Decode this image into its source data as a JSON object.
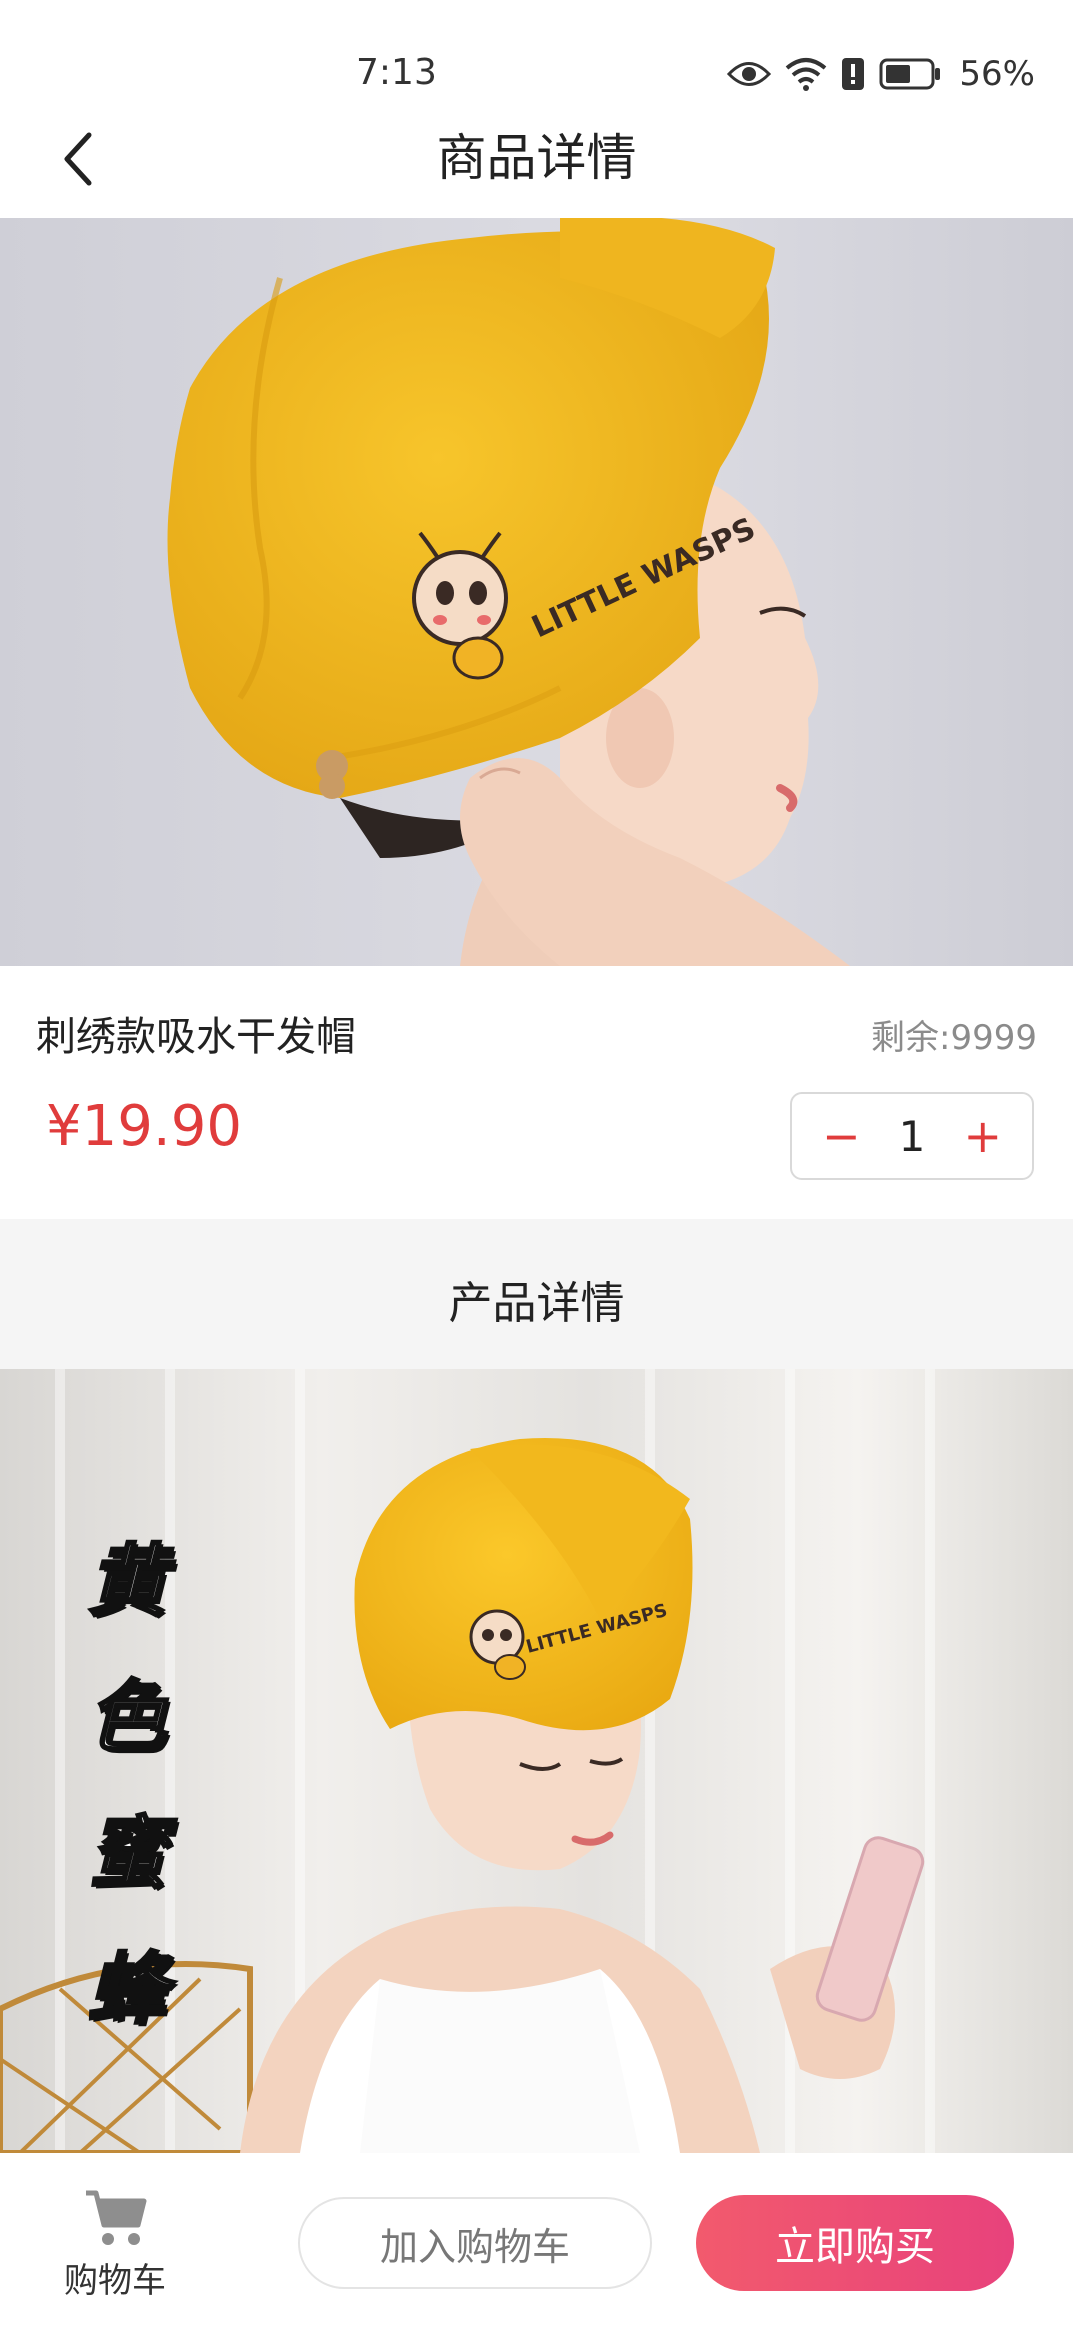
{
  "status_bar": {
    "time": "7:13",
    "battery_percent": "56%",
    "icons": [
      "eye-icon",
      "wifi-icon",
      "alert-icon",
      "battery-icon"
    ]
  },
  "header": {
    "back_icon": "chevron-left-icon",
    "title": "商品详情"
  },
  "hero": {
    "embroidery_text": "LITTLE WASPS"
  },
  "product": {
    "name": "刺绣款吸水干发帽",
    "stock_label": "剩余:",
    "stock_value": "9999",
    "price": "¥19.90",
    "quantity": {
      "minus": "−",
      "value": "1",
      "plus": "+"
    }
  },
  "details": {
    "title": "产品详情",
    "image_vertical_text": [
      "黄",
      "色",
      "蜜",
      "蜂"
    ],
    "embroidery_text": "LITTLE WASPS"
  },
  "bottom_bar": {
    "cart_icon": "shopping-cart-icon",
    "cart_label": "购物车",
    "add_to_cart": "加入购物车",
    "buy_now": "立即购买"
  },
  "colors": {
    "price": "#e03c3c",
    "buy_gradient_start": "#f25a6d",
    "buy_gradient_end": "#e8427c",
    "towel_yellow": "#f3b81f",
    "detail_header_bg": "#f5f5f5"
  }
}
